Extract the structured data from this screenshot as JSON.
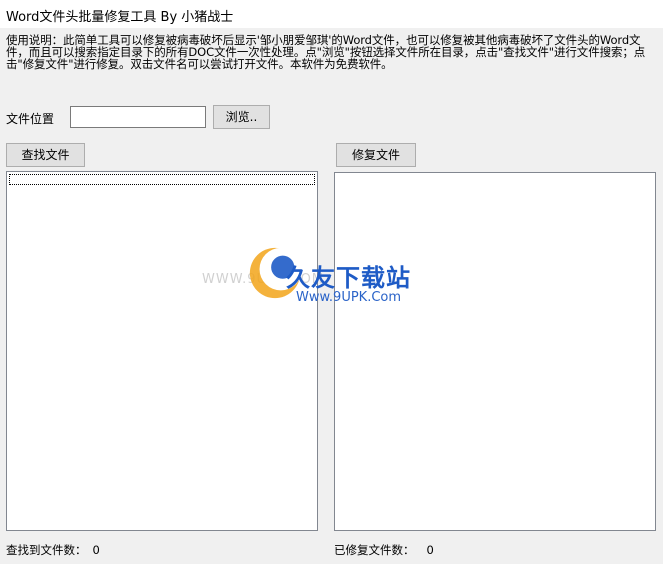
{
  "window": {
    "title": "Word文件头批量修复工具  By 小猪战士"
  },
  "description": "使用说明：此简单工具可以修复被病毒破坏后显示'邹小朋爱邹琪'的Word文件，也可以修复被其他病毒破坏了文件头的Word文件，而且可以搜索指定目录下的所有DOC文件一次性处理。点\"浏览\"按钮选择文件所在目录，点击\"查找文件\"进行文件搜索；点击\"修复文件\"进行修复。双击文件名可以尝试打开文件。本软件为免费软件。",
  "location": {
    "label": "文件位置",
    "value": "",
    "browse_label": "浏览.."
  },
  "actions": {
    "find_label": "查找文件",
    "repair_label": "修复文件"
  },
  "status": {
    "found_label": "查找到文件数：",
    "found_count": "0",
    "repaired_label": "已修复文件数：",
    "repaired_count": "0"
  },
  "watermark": {
    "main": "久友下载站",
    "sub": "Www.9UPK.Com",
    "faint": "WWW.9UPK.COM"
  },
  "colors": {
    "window_bg": "#f0f0f0",
    "button_bg": "#e1e1e1",
    "watermark_blue": "#1e5bc6",
    "watermark_orange": "#f2a51a"
  }
}
